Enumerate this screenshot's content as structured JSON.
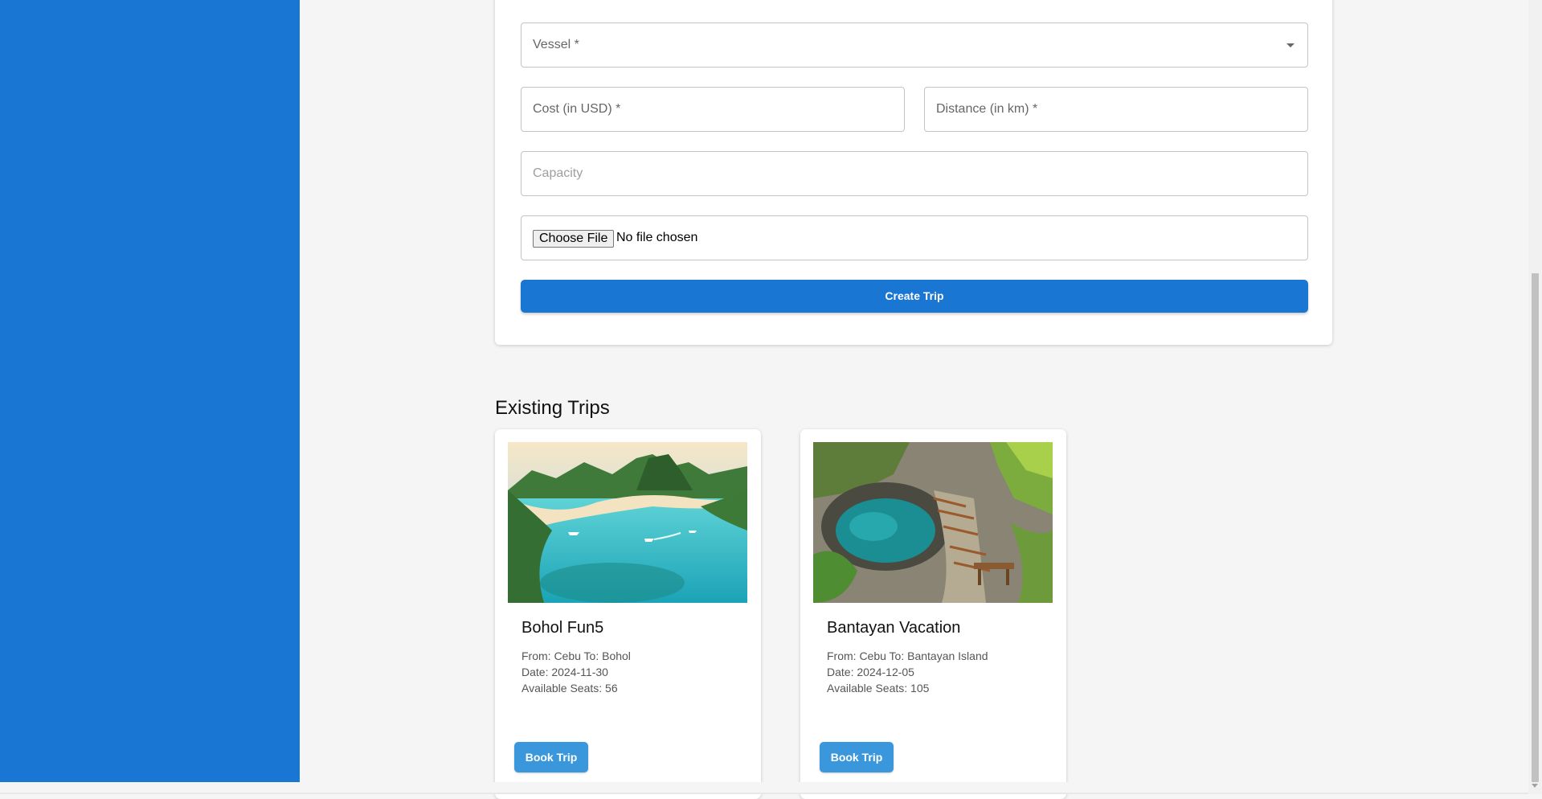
{
  "form": {
    "vessel_label": "Vessel *",
    "cost_label": "Cost (in USD) *",
    "distance_label": "Distance (in km) *",
    "capacity_placeholder": "Capacity",
    "file_button": "Choose File",
    "file_status": "No file chosen",
    "submit_label": "Create Trip"
  },
  "existing": {
    "title": "Existing Trips",
    "trips": [
      {
        "name": "Bohol Fun5",
        "route": "From: Cebu To: Bohol",
        "date": "Date: 2024-11-30",
        "seats": "Available Seats: 56",
        "button": "Book Trip"
      },
      {
        "name": "Bantayan Vacation",
        "route": "From: Cebu To: Bantayan Island",
        "date": "Date: 2024-12-05",
        "seats": "Available Seats: 105",
        "button": "Book Trip"
      }
    ]
  },
  "colors": {
    "sidebar": "#1976d2",
    "primary_button": "#1976d2",
    "book_button": "#3a97dc",
    "background": "#f5f5f5"
  },
  "icons": {
    "vessel_dropdown": "caret-down-icon"
  }
}
